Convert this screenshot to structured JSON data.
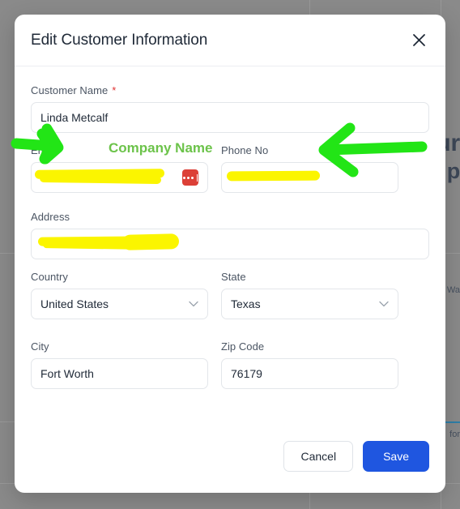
{
  "overlay": {
    "scrim_color": "#8a8a8a"
  },
  "background_app": {
    "heading_line1": "ur",
    "heading_line2": "p",
    "small_text_1": "Wa",
    "small_text_2": "for"
  },
  "dialog": {
    "title": "Edit Customer Information",
    "close_icon": "close-x-icon",
    "fields": [
      {
        "id": "customer_name",
        "label": "Customer Name",
        "required": true,
        "required_marker": "*",
        "value": "Linda Metcalf",
        "type": "text",
        "redacted": false
      },
      {
        "id": "email",
        "label": "Email",
        "required": false,
        "value": "",
        "type": "text",
        "redacted": true,
        "badge_icon": "password-manager-icon"
      },
      {
        "id": "phone_no",
        "label": "Phone No",
        "required": false,
        "value": "",
        "type": "text",
        "redacted": true
      },
      {
        "id": "address",
        "label": "Address",
        "required": false,
        "value": "",
        "type": "text",
        "redacted": true
      },
      {
        "id": "country",
        "label": "Country",
        "required": false,
        "value": "United States",
        "type": "select",
        "redacted": false,
        "chevron_icon": "chevron-down-icon"
      },
      {
        "id": "state",
        "label": "State",
        "required": false,
        "value": "Texas",
        "type": "select",
        "redacted": false,
        "chevron_icon": "chevron-down-icon"
      },
      {
        "id": "city",
        "label": "City",
        "required": false,
        "value": "Fort Worth",
        "type": "text",
        "redacted": false
      },
      {
        "id": "zip_code",
        "label": "Zip Code",
        "required": false,
        "value": "76179",
        "type": "text",
        "redacted": false
      }
    ],
    "footer": {
      "cancel_label": "Cancel",
      "save_label": "Save"
    }
  },
  "annotations": {
    "label_text": "Company Name",
    "label_color": "#6cc34a",
    "arrow_color": "#22e516",
    "arrow_left_icon": "arrow-right-annotation-icon",
    "arrow_right_icon": "arrow-left-annotation-icon",
    "redaction_color": "#fbf500"
  },
  "colors": {
    "accent_blue": "#1f56e0",
    "required_red": "#e03131",
    "badge_red": "#dc4037",
    "text_primary": "#1f2937",
    "label_gray": "#4b5563",
    "border_gray": "#e3e6ea"
  }
}
